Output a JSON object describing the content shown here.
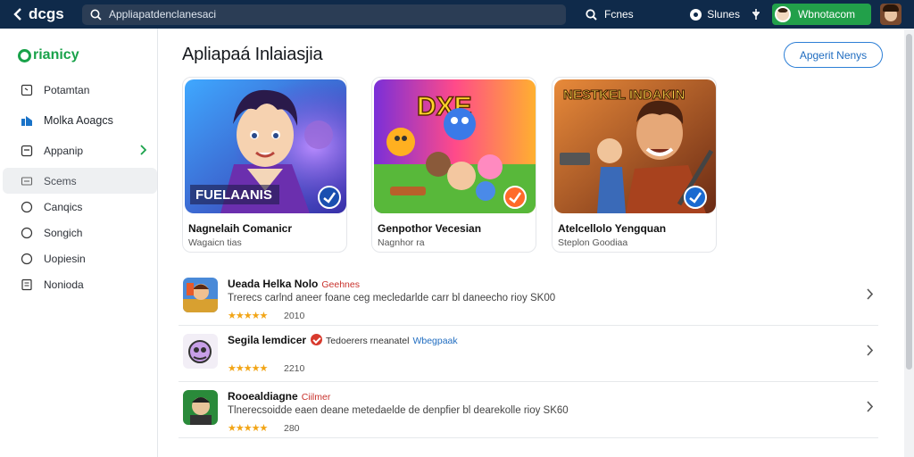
{
  "topbar": {
    "back_label": "dcgs",
    "search_placeholder": "Appliapatdenclanesaci",
    "search_button_label": "Fcnes",
    "status_label": "Slunes",
    "account_label": "Wbnotacom"
  },
  "sidebar": {
    "logo_text": "rianicy",
    "items": [
      {
        "label": "Potamtan"
      },
      {
        "label": "Molka Aoagcs"
      },
      {
        "label": "Appanip"
      },
      {
        "label": "Scems"
      },
      {
        "label": "Canqics"
      },
      {
        "label": "Songich"
      },
      {
        "label": "Uopiesin"
      },
      {
        "label": "Nonioda"
      }
    ]
  },
  "main": {
    "heading": "Apliapaá Inlaiasjia",
    "view_all_label": "Apgerit Nenys",
    "featured": [
      {
        "banner": "FUELAANIS",
        "title": "Nagnelaih Comanicr",
        "subtitle": "Wagaicn tias"
      },
      {
        "banner": "DXE",
        "title": "Genpothor Vecesian",
        "subtitle": "Nagnhor ra"
      },
      {
        "banner": "NESTKEL INDAKIN",
        "title": "Atelcellolo Yengquan",
        "subtitle": "Steplon Goodiaa"
      }
    ],
    "list": [
      {
        "name": "Ueada Helka Nolo",
        "tag": "Geehnes",
        "description": "Trerecs carlnd aneer foane ceg mecledarlde carr bl daneecho rioy SK00",
        "stars": "★★★★★",
        "count": "2010"
      },
      {
        "name": "Segila lemdicer",
        "tag": "Tedoerers rneanatel",
        "tag2": "Wbegpaak",
        "description": "",
        "stars": "★★★★★",
        "count": "2210"
      },
      {
        "name": "Rooealdiagne",
        "tag": "Ciilmer",
        "description": "Tlnerecsoidde eaen deane metedaelde de denpfier bl dearekolle rioy SK60",
        "stars": "★★★★★",
        "count": "280"
      }
    ]
  },
  "colors": {
    "topbar": "#0f2a4a",
    "accent_green": "#22a04a",
    "accent_blue": "#2d7fd6",
    "star": "#f2a516",
    "tag_red": "#c8322c"
  },
  "icons": {
    "back": "chevron-left-icon",
    "search": "search-icon",
    "status": "radio-dot-icon",
    "pin": "pin-icon",
    "nav": [
      "square-icon",
      "chart-icon",
      "app-icon",
      "grid-icon",
      "circle-icon",
      "circle-icon",
      "circle-icon",
      "document-icon"
    ],
    "row_arrow": "chevron-right-icon"
  }
}
